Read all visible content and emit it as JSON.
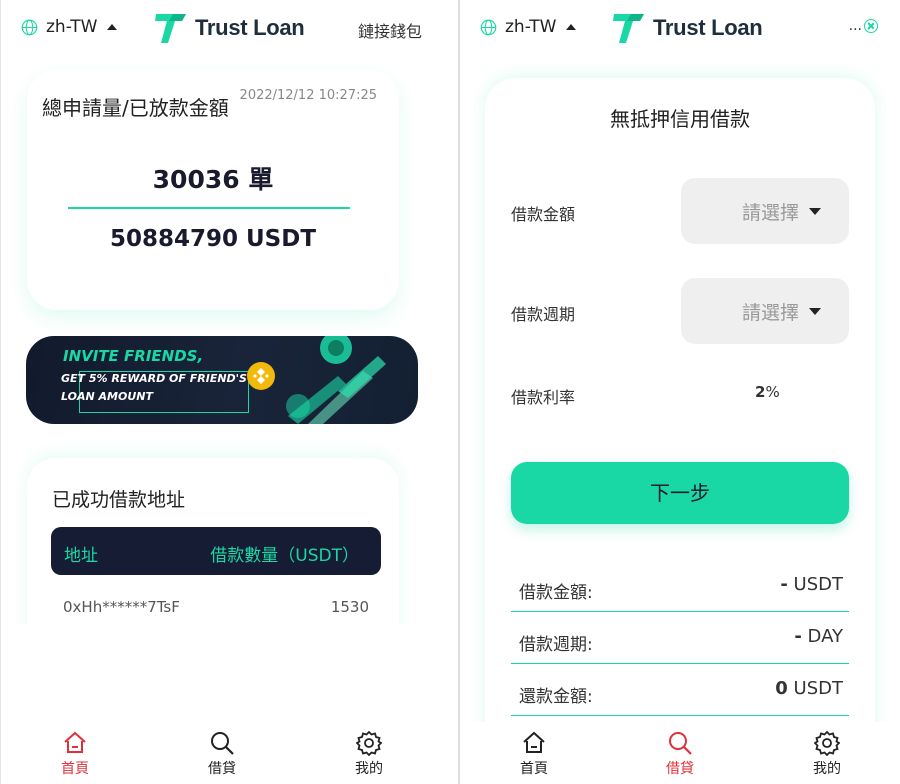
{
  "left": {
    "header": {
      "lang": "zh-TW",
      "brand": "Trust Loan",
      "connect_wallet": "鏈接錢包"
    },
    "stats": {
      "title": "總申請量/已放款金額",
      "timestamp": "2022/12/12 10:27:25",
      "count": "30036 單",
      "amount": "50884790 USDT"
    },
    "banner": {
      "title": "INVITE FRIENDS,",
      "line1": "GET 5% REWARD OF FRIEND'S",
      "line2": "LOAN AMOUNT"
    },
    "success_list": {
      "title": "已成功借款地址",
      "col_address": "地址",
      "col_amount": "借款數量（USDT）",
      "rows": [
        {
          "address": "0xHh******7TsF",
          "amount": "1530"
        }
      ]
    }
  },
  "right": {
    "header": {
      "lang": "zh-TW",
      "brand": "Trust Loan",
      "more": "..."
    },
    "form": {
      "title": "無抵押信用借款",
      "amount_label": "借款金額",
      "amount_placeholder": "請選擇",
      "period_label": "借款週期",
      "period_placeholder": "請選擇",
      "rate_label": "借款利率",
      "rate_value": "2",
      "rate_unit": "%",
      "next_button": "下一步"
    },
    "summary": [
      {
        "label": "借款金額:",
        "value": "-",
        "unit": " USDT"
      },
      {
        "label": "借款週期:",
        "value": "-",
        "unit": " DAY"
      },
      {
        "label": "還款金額:",
        "value": "0",
        "unit": " USDT"
      }
    ]
  },
  "nav": {
    "home": "首頁",
    "loan": "借貸",
    "mine": "我的"
  },
  "colors": {
    "accent": "#19d8a6",
    "active_nav": "#e0303a",
    "dark": "#161c33"
  },
  "icons": [
    "globe-icon",
    "caret-up-icon",
    "logo-icon",
    "close-circle-icon",
    "home-icon",
    "search-icon",
    "gear-icon",
    "caret-down-icon",
    "binance-icon"
  ]
}
